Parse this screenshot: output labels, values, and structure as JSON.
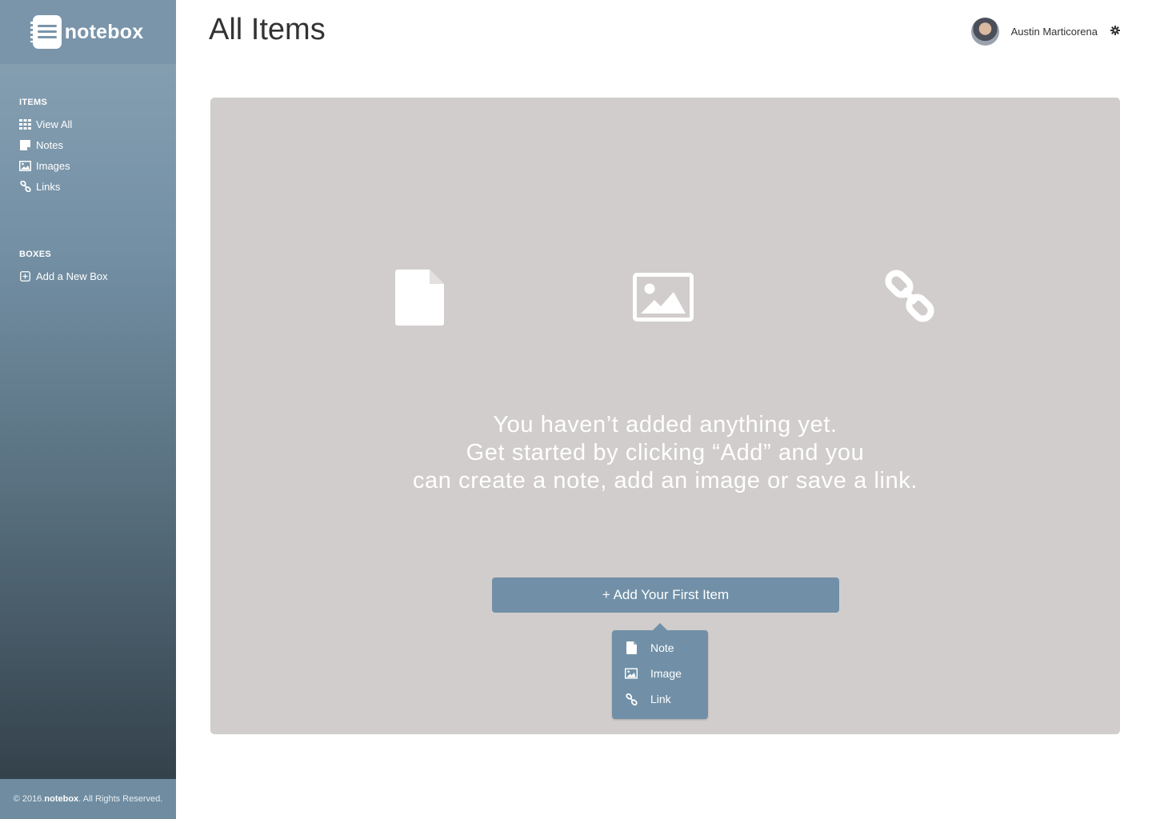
{
  "brand": {
    "name": "notebox"
  },
  "sidebar": {
    "items_heading": "ITEMS",
    "items": [
      {
        "label": "View All",
        "icon": "grid-icon"
      },
      {
        "label": "Notes",
        "icon": "note-icon"
      },
      {
        "label": "Images",
        "icon": "image-icon"
      },
      {
        "label": "Links",
        "icon": "link-icon"
      }
    ],
    "boxes_heading": "BOXES",
    "boxes": [
      {
        "label": "Add a New Box",
        "icon": "plus-square-icon"
      }
    ],
    "footer": {
      "prefix": "© 2016. ",
      "brand": "notebox",
      "suffix": ". All Rights Reserved."
    }
  },
  "header": {
    "title": "All Items",
    "user_name": "Austin Marticorena"
  },
  "main": {
    "empty_lines": [
      "You haven’t added anything yet.",
      "Get started by clicking “Add” and you",
      "can create a note, add an image or save a link."
    ],
    "add_button": "+ Add Your First Item",
    "dropdown": [
      {
        "label": "Note",
        "icon": "note-icon"
      },
      {
        "label": "Image",
        "icon": "image-icon"
      },
      {
        "label": "Link",
        "icon": "link-icon"
      }
    ]
  },
  "colors": {
    "sidebar_top": "#8aa3b5",
    "sidebar_bottom": "#2f3b44",
    "accent": "#7190a7",
    "panel": "#d1cdcc"
  }
}
